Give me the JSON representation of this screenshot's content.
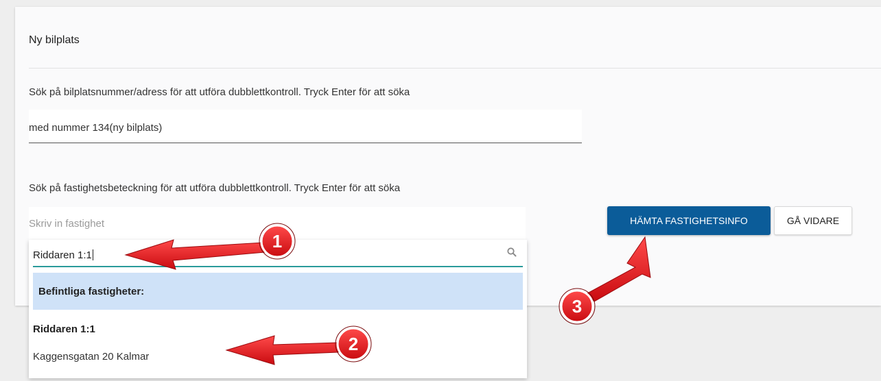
{
  "form": {
    "title": "Ny bilplats",
    "search_address_label": "Sök på bilplatsnummer/adress för att utföra dubblettkontroll. Tryck Enter för att söka",
    "search_address_value": "med nummer 134(ny bilplats)",
    "search_property_label": "Sök på fastighetsbeteckning för att utföra dubblettkontroll. Tryck Enter för att söka",
    "property_placeholder": "Skriv in fastighet"
  },
  "dropdown": {
    "search_value": "Riddaren 1:1",
    "group_header": "Befintliga fastigheter:",
    "options": [
      {
        "title": "Riddaren 1:1",
        "subtitle": "Kaggensgatan 20 Kalmar"
      }
    ]
  },
  "buttons": {
    "fetch_label": "HÄMTA FASTIGHETSINFO",
    "continue_label": "GÅ VIDARE"
  },
  "annotations": {
    "marker_1": "1",
    "marker_2": "2",
    "marker_3": "3",
    "arrow_color": "#e8141c"
  },
  "colors": {
    "primary_button": "#0b5c99",
    "focus_underline": "#2a9a9a",
    "group_highlight": "#cfe2f8"
  }
}
